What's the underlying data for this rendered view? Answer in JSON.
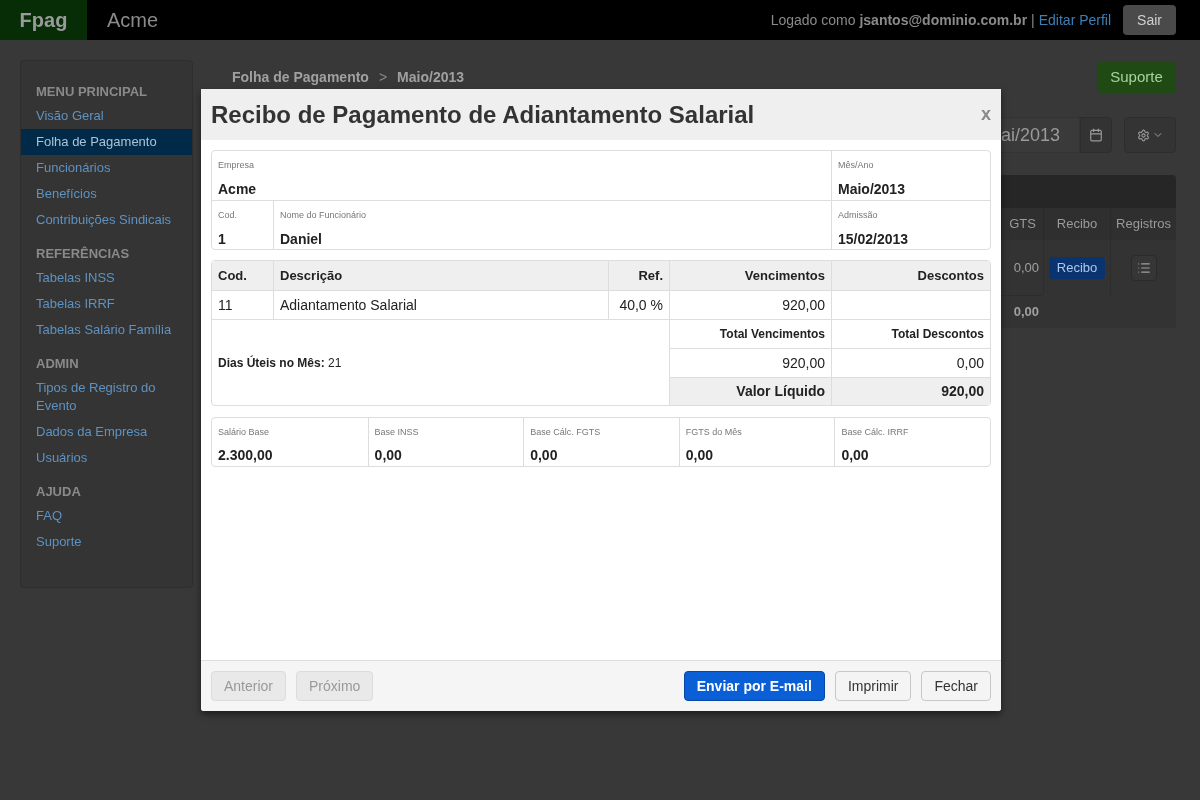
{
  "header": {
    "brand": "Fpag",
    "company": "Acme",
    "logged_prefix": "Logado como",
    "user": "jsantos@dominio.com.br",
    "separator": "|",
    "edit_profile": "Editar Perfil",
    "logout": "Sair"
  },
  "sidebar": {
    "sections": [
      {
        "title": "MENU PRINCIPAL",
        "items": [
          {
            "label": "Visão Geral",
            "selected": false
          },
          {
            "label": "Folha de Pagamento",
            "selected": true
          },
          {
            "label": "Funcionários",
            "selected": false
          },
          {
            "label": "Benefícios",
            "selected": false
          },
          {
            "label": "Contribuições Sindicais",
            "selected": false
          }
        ]
      },
      {
        "title": "REFERÊNCIAS",
        "items": [
          {
            "label": "Tabelas INSS",
            "selected": false
          },
          {
            "label": "Tabelas IRRF",
            "selected": false
          },
          {
            "label": "Tabelas Salário Família",
            "selected": false
          }
        ]
      },
      {
        "title": "ADMIN",
        "items": [
          {
            "label": "Tipos de Registro do Evento",
            "selected": false
          },
          {
            "label": "Dados da Empresa",
            "selected": false
          },
          {
            "label": "Usuários",
            "selected": false
          }
        ]
      },
      {
        "title": "AJUDA",
        "items": [
          {
            "label": "FAQ",
            "selected": false
          },
          {
            "label": "Suporte",
            "selected": false
          }
        ]
      }
    ]
  },
  "main": {
    "breadcrumb": [
      "Folha de Pagamento",
      "Maio/2013"
    ],
    "breadcrumb_separator": ">",
    "support_button": "Suporte",
    "period_field": "ai/2013",
    "table": {
      "columns": [
        "GTS",
        "Recibo",
        "Registros"
      ],
      "rows": [
        {
          "value": "0,00",
          "receipt_button": "Recibo"
        }
      ],
      "total": "0,00"
    }
  },
  "modal": {
    "title": "Recibo de Pagamento de Adiantamento Salarial",
    "close": "x",
    "company": {
      "label": "Empresa",
      "value": "Acme"
    },
    "month": {
      "label": "Mês/Ano",
      "value": "Maio/2013"
    },
    "code": {
      "label": "Cod.",
      "value": "1"
    },
    "employee": {
      "label": "Nome do Funcionário",
      "value": "Daniel"
    },
    "admission": {
      "label": "Admissão",
      "value": "15/02/2013"
    },
    "items": {
      "columns": [
        "Cod.",
        "Descrição",
        "Ref.",
        "Vencimentos",
        "Descontos"
      ],
      "rows": [
        {
          "cells": [
            "11",
            "Adiantamento Salarial",
            "40,0 %",
            "920,00",
            ""
          ]
        }
      ]
    },
    "workdays": {
      "label": "Dias Úteis no Mês:",
      "value": "21"
    },
    "totals": {
      "earnings_label": "Total Vencimentos",
      "deductions_label": "Total Descontos",
      "earnings": "920,00",
      "deductions": "0,00",
      "net_label": "Valor Líquido",
      "net": "920,00"
    },
    "bases": [
      {
        "label": "Salário Base",
        "value": "2.300,00"
      },
      {
        "label": "Base INSS",
        "value": "0,00"
      },
      {
        "label": "Base Cálc. FGTS",
        "value": "0,00"
      },
      {
        "label": "FGTS do Mês",
        "value": "0,00"
      },
      {
        "label": "Base Cálc. IRRF",
        "value": "0,00"
      }
    ],
    "footer_left": [
      {
        "label": "Anterior",
        "disabled": true
      },
      {
        "label": "Próximo",
        "disabled": true
      }
    ],
    "footer_right": [
      {
        "label": "Enviar por E-mail",
        "kind": "primary",
        "disabled": false
      },
      {
        "label": "Imprimir",
        "kind": "default",
        "disabled": false
      },
      {
        "label": "Fechar",
        "kind": "default",
        "disabled": false
      }
    ]
  }
}
